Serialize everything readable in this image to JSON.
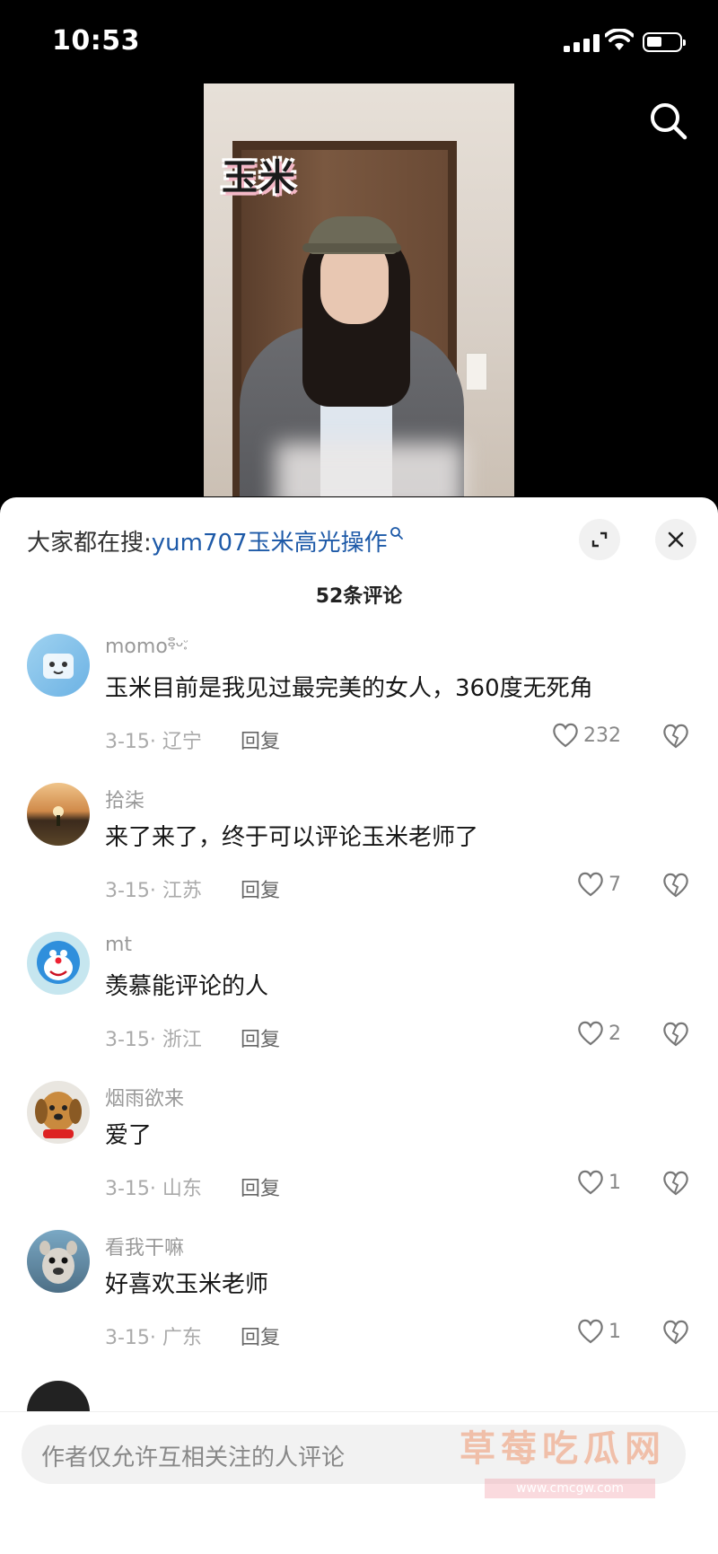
{
  "status_bar": {
    "time": "10:53"
  },
  "video": {
    "sticker_text": "玉米"
  },
  "panel": {
    "hot_search_prefix": "大家都在搜:",
    "hot_search_keyword": "yum707玉米高光操作",
    "comment_count": "52条评论"
  },
  "comments": [
    {
      "user": "momo",
      "user_suffix": "ⵓ̥ᴗᵕ̥",
      "text": "玉米目前是我见过最完美的女人，360度无死角",
      "date_loc": "3-15· 辽宁",
      "reply": "回复",
      "likes": "232"
    },
    {
      "user": "拾柒",
      "user_suffix": "",
      "text": "来了来了，终于可以评论玉米老师了",
      "date_loc": "3-15· 江苏",
      "reply": "回复",
      "likes": "7"
    },
    {
      "user": "mt",
      "user_suffix": "",
      "text": "羡慕能评论的人",
      "date_loc": "3-15· 浙江",
      "reply": "回复",
      "likes": "2"
    },
    {
      "user": "烟雨欲来",
      "user_suffix": "",
      "text": "爱了",
      "date_loc": "3-15· 山东",
      "reply": "回复",
      "likes": "1"
    },
    {
      "user": "看我干嘛",
      "user_suffix": "",
      "text": "好喜欢玉米老师",
      "date_loc": "3-15· 广东",
      "reply": "回复",
      "likes": "1"
    }
  ],
  "bottom_bar": {
    "input_placeholder": "作者仅允许互相关注的人评论",
    "watermark": "草莓吃瓜网",
    "watermark_url": "www.cmcgw.com"
  },
  "icons": [
    "search-icon",
    "expand-icon",
    "close-icon",
    "heart-icon",
    "dislike-heart-icon",
    "signal-icon",
    "wifi-icon",
    "battery-icon"
  ]
}
